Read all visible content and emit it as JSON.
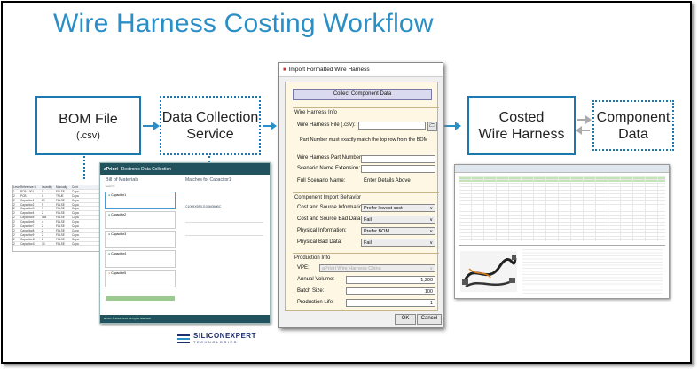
{
  "title": "Wire Harness Costing Workflow",
  "boxes": {
    "bom": {
      "line1": "BOM File",
      "line2": "(.csv)"
    },
    "dcs": {
      "line1": "Data Collection",
      "line1b": "Service"
    },
    "costed": {
      "line1": "Costed",
      "line1b": "Wire Harness"
    },
    "component": {
      "line1": "Component",
      "line1b": "Data"
    }
  },
  "apriori": {
    "brand": "aPriori",
    "app_title": "Electronic Data Collection",
    "bom_heading": "Bill of Materials",
    "matches_heading": "Matches for Capacitor1",
    "cards": [
      "Capacitor1",
      "Capacitor2",
      "Capacitor3",
      "Capacitor4",
      "Capacitor5"
    ],
    "match_part": "C1005X5R0J106M050BC",
    "footer": "aPriori © 2018-2019. All rights reserved."
  },
  "sheet": {
    "headers": [
      "Level",
      "Reference D",
      "Quantity",
      "Manually",
      "Cont"
    ],
    "rows": [
      [
        "1",
        "PCBA-001",
        "1",
        "FALSE",
        "Capa"
      ],
      [
        "2",
        "PCB",
        "1",
        "TRUE",
        "Capa"
      ],
      [
        "2",
        "Capacitor1",
        "20",
        "FALSE",
        "Capa"
      ],
      [
        "2",
        "Capacitor2",
        "9",
        "FALSE",
        "Capa"
      ],
      [
        "2",
        "Capacitor3",
        "9",
        "FALSE",
        "Capa"
      ],
      [
        "2",
        "Capacitor4",
        "2",
        "FALSE",
        "Capa"
      ],
      [
        "2",
        "Capacitor5",
        "165",
        "FALSE",
        "Capa"
      ],
      [
        "2",
        "Capacitor6",
        "4",
        "FALSE",
        "Capa"
      ],
      [
        "2",
        "Capacitor7",
        "2",
        "FALSE",
        "Capa"
      ],
      [
        "2",
        "Capacitor8",
        "2",
        "FALSE",
        "Capa"
      ],
      [
        "2",
        "Capacitor9",
        "2",
        "FALSE",
        "Capa"
      ],
      [
        "2",
        "Capacitor10",
        "2",
        "FALSE",
        "Capa"
      ],
      [
        "2",
        "Capacitor11",
        "30",
        "FALSE",
        "Capa"
      ]
    ]
  },
  "dialog": {
    "title": "Import Formatted Wire Harness",
    "collect_button": "Collect Component Data",
    "section_info": "Wire Harness Info",
    "file_label": "Wire Harness File (.csv):",
    "note": "Part Number must exactly match the top row from the BOM",
    "part_number_label": "Wire Harness Part Number:",
    "scenario_ext_label": "Scenario Name Extension:",
    "full_scenario_label": "Full Scenario Name:",
    "full_scenario_value": "Enter Details Above",
    "section_import": "Component Import Behavior",
    "cost_info_label": "Cost and Source Information:",
    "cost_info_value": "Prefer lowest cost",
    "bad_data_label": "Cost and Source Bad Data:",
    "bad_data_value": "Fail",
    "phys_info_label": "Physical Information:",
    "phys_info_value": "Prefer BOM",
    "phys_bad_label": "Physical Bad Data:",
    "phys_bad_value": "Fail",
    "section_production": "Production Info",
    "vpe_label": "VPE:",
    "vpe_value": "aPriori Wire Harness China",
    "annual_label": "Annual Volume:",
    "annual_value": "1,200",
    "batch_label": "Batch Size:",
    "batch_value": "100",
    "life_label": "Production Life:",
    "life_value": "1",
    "ok": "OK",
    "cancel": "Cancel"
  },
  "logo": {
    "name": "SILICONEXPERT",
    "sub": "TECHNOLOGIES"
  },
  "colors": {
    "accent": "#2a8fc7",
    "box_border": "#1e78b0",
    "dialog_panel": "#fdf7e4",
    "apriori_header": "#23525f"
  }
}
